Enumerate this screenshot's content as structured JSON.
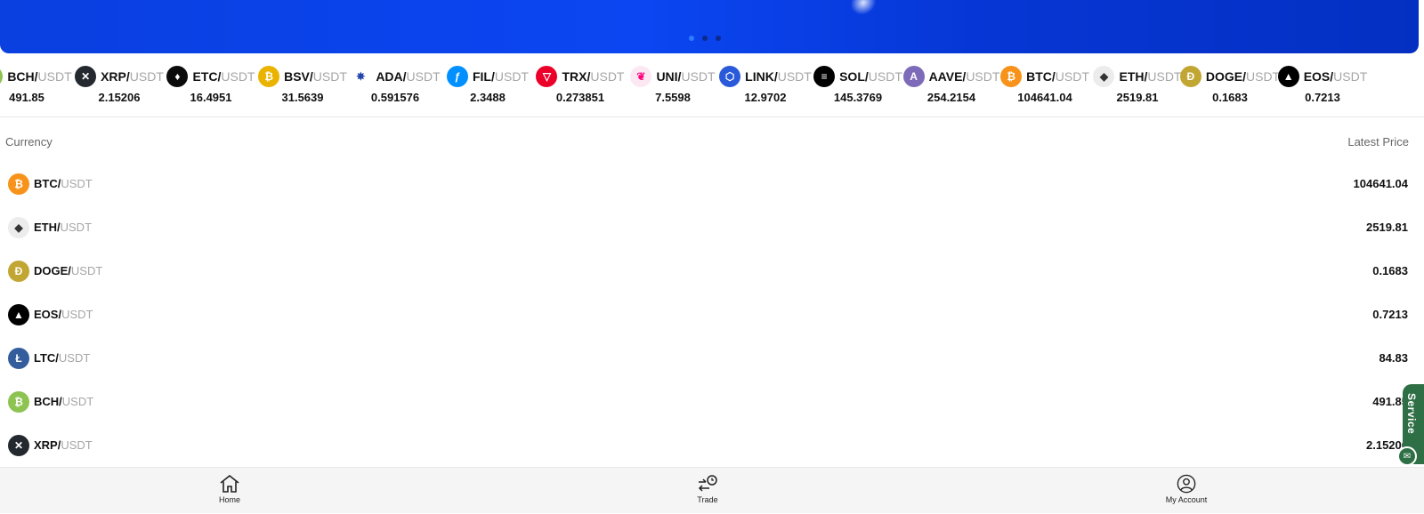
{
  "ticker": [
    {
      "base": "BCH/",
      "quote": "USDT",
      "price": "491.85",
      "icon": "bch-icon",
      "color": "#8dc351",
      "glyph": "₿"
    },
    {
      "base": "XRP/",
      "quote": "USDT",
      "price": "2.15206",
      "icon": "xrp-icon",
      "color": "#23292f",
      "glyph": "✕"
    },
    {
      "base": "ETC/",
      "quote": "USDT",
      "price": "16.4951",
      "icon": "etc-icon",
      "color": "#0b0b0b",
      "glyph": "♦"
    },
    {
      "base": "BSV/",
      "quote": "USDT",
      "price": "31.5639",
      "icon": "bsv-icon",
      "color": "#eab300",
      "glyph": "₿"
    },
    {
      "base": "ADA/",
      "quote": "USDT",
      "price": "0.591576",
      "icon": "ada-icon",
      "color": "#ffffff",
      "glyph": "✵"
    },
    {
      "base": "FIL/",
      "quote": "USDT",
      "price": "2.3488",
      "icon": "fil-icon",
      "color": "#0090ff",
      "glyph": "ƒ"
    },
    {
      "base": "TRX/",
      "quote": "USDT",
      "price": "0.273851",
      "icon": "trx-icon",
      "color": "#eb0029",
      "glyph": "▽"
    },
    {
      "base": "UNI/",
      "quote": "USDT",
      "price": "7.5598",
      "icon": "uni-icon",
      "color": "#fce8f3",
      "glyph": "❦"
    },
    {
      "base": "LINK/",
      "quote": "USDT",
      "price": "12.9702",
      "icon": "link-icon",
      "color": "#2a5ada",
      "glyph": "⬡"
    },
    {
      "base": "SOL/",
      "quote": "USDT",
      "price": "145.3769",
      "icon": "sol-icon",
      "color": "#000000",
      "glyph": "≡"
    },
    {
      "base": "AAVE/",
      "quote": "USDT",
      "price": "254.2154",
      "icon": "aave-icon",
      "color": "#7d6ab8",
      "glyph": "A"
    },
    {
      "base": "BTC/",
      "quote": "USDT",
      "price": "104641.04",
      "icon": "btc-icon",
      "color": "#f7931a",
      "glyph": "₿"
    },
    {
      "base": "ETH/",
      "quote": "USDT",
      "price": "2519.81",
      "icon": "eth-icon",
      "color": "#ececec",
      "glyph": "◆"
    },
    {
      "base": "DOGE/",
      "quote": "USDT",
      "price": "0.1683",
      "icon": "doge-icon",
      "color": "#c2a633",
      "glyph": "Ð"
    },
    {
      "base": "EOS/",
      "quote": "USDT",
      "price": "0.7213",
      "icon": "eos-icon",
      "color": "#000000",
      "glyph": "▲"
    }
  ],
  "table": {
    "col_currency": "Currency",
    "col_price": "Latest Price",
    "rows": [
      {
        "base": "BTC/",
        "quote": "USDT",
        "price": "104641.04",
        "icon": "btc-icon",
        "color": "#f7931a",
        "glyph": "₿"
      },
      {
        "base": "ETH/",
        "quote": "USDT",
        "price": "2519.81",
        "icon": "eth-icon",
        "color": "#ececec",
        "glyph": "◆"
      },
      {
        "base": "DOGE/",
        "quote": "USDT",
        "price": "0.1683",
        "icon": "doge-icon",
        "color": "#c2a633",
        "glyph": "Ð"
      },
      {
        "base": "EOS/",
        "quote": "USDT",
        "price": "0.7213",
        "icon": "eos-icon",
        "color": "#000000",
        "glyph": "▲"
      },
      {
        "base": "LTC/",
        "quote": "USDT",
        "price": "84.83",
        "icon": "ltc-icon",
        "color": "#345d9d",
        "glyph": "Ł"
      },
      {
        "base": "BCH/",
        "quote": "USDT",
        "price": "491.85",
        "icon": "bch-icon",
        "color": "#8dc351",
        "glyph": "₿"
      },
      {
        "base": "XRP/",
        "quote": "USDT",
        "price": "2.15206",
        "icon": "xrp-icon",
        "color": "#23292f",
        "glyph": "✕"
      }
    ]
  },
  "service": {
    "label": "Service"
  },
  "nav": {
    "home": "Home",
    "trade": "Trade",
    "account": "My Account"
  },
  "colors": {
    "banner": "#0b46f2",
    "service": "#2f6f45"
  }
}
